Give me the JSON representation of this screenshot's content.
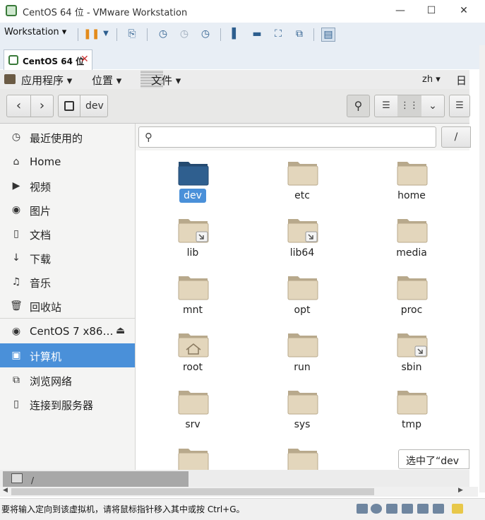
{
  "window": {
    "title": "CentOS 64 位 - VMware Workstation",
    "minimize": "—",
    "maximize": "☐",
    "close": "✕"
  },
  "vm_toolbar": {
    "workstation_menu": "Workstation ▾"
  },
  "tab": {
    "label": "CentOS 64 位",
    "close": "✕"
  },
  "gnome_bar": {
    "applications": "应用程序 ▾",
    "places": "位置 ▾",
    "files": "文件 ▾",
    "lang": "zh ▾",
    "date_partial": "日"
  },
  "header": {
    "location": "dev",
    "path_root": "/"
  },
  "sidebar": {
    "items": [
      {
        "label": "最近使用的",
        "icon": "clock-icon"
      },
      {
        "label": "Home",
        "icon": "home-icon"
      },
      {
        "label": "视频",
        "icon": "video-icon"
      },
      {
        "label": "图片",
        "icon": "camera-icon"
      },
      {
        "label": "文档",
        "icon": "document-icon"
      },
      {
        "label": "下载",
        "icon": "download-icon"
      },
      {
        "label": "音乐",
        "icon": "music-icon"
      },
      {
        "label": "回收站",
        "icon": "trash-icon"
      },
      {
        "label": "CentOS 7 x86…",
        "icon": "disc-icon"
      },
      {
        "label": "计算机",
        "icon": "computer-icon"
      },
      {
        "label": "浏览网络",
        "icon": "network-icon"
      },
      {
        "label": "连接到服务器",
        "icon": "server-icon"
      }
    ]
  },
  "folders": [
    {
      "name": "dev",
      "selected": true
    },
    {
      "name": "etc"
    },
    {
      "name": "home"
    },
    {
      "name": "lib",
      "link": true
    },
    {
      "name": "lib64",
      "link": true
    },
    {
      "name": "media"
    },
    {
      "name": "mnt"
    },
    {
      "name": "opt"
    },
    {
      "name": "proc"
    },
    {
      "name": "root",
      "home_emblem": true
    },
    {
      "name": "run"
    },
    {
      "name": "sbin",
      "link": true
    },
    {
      "name": "srv"
    },
    {
      "name": "sys"
    },
    {
      "name": "tmp"
    }
  ],
  "status_popup": "选中了“dev",
  "bottom_path": "/",
  "statusbar": {
    "hint": "要将输入定向到该虚拟机，请将鼠标指针移入其中或按 Ctrl+G。"
  },
  "colors": {
    "selection": "#4a90d9",
    "folder_body": "#e3d6bc",
    "folder_tab": "#b8a98c",
    "selected_folder": "#2f5f8f"
  }
}
